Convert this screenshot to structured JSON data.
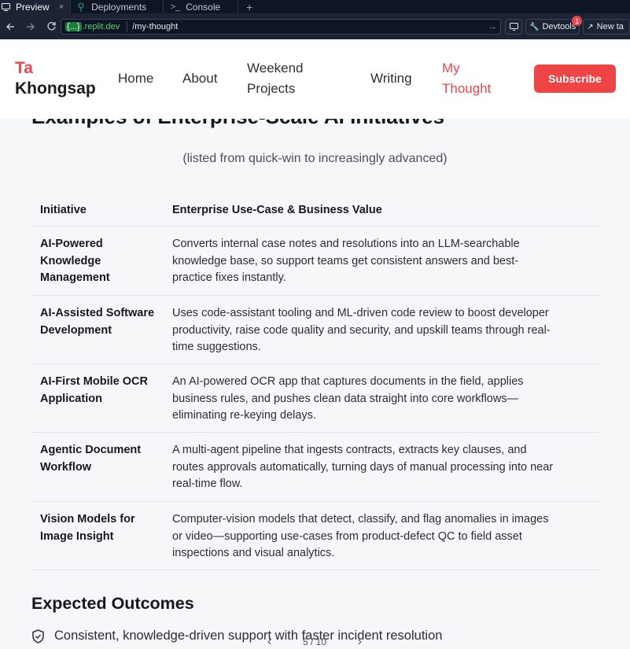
{
  "ide": {
    "tabs": [
      {
        "label": "Preview",
        "close": "×"
      },
      {
        "label": "Deployments"
      },
      {
        "label": "Console"
      }
    ],
    "new_tab_symbol": "+",
    "address": {
      "domain_braces": "{...}",
      "domain": ".replit.dev",
      "path": "/my-thought"
    },
    "devtools_label": "Devtools",
    "devtools_badge": "1",
    "new_tab_label": "New ta"
  },
  "site": {
    "logo_first": "Ta",
    "logo_last": "Khongsap",
    "nav": [
      {
        "label_lines": [
          "Home"
        ]
      },
      {
        "label_lines": [
          "About"
        ]
      },
      {
        "label_lines": [
          "Weekend",
          "Projects"
        ]
      },
      {
        "label_lines": [
          "Writing"
        ]
      },
      {
        "label_lines": [
          "My",
          "Thought"
        ],
        "active": true
      }
    ],
    "subscribe_label": "Subscribe",
    "accent_color": "#ef4444"
  },
  "article": {
    "section_heading_cut": "Examples of Enterprise-Scale AI Initiatives",
    "subtitle": "(listed from quick-win to increasingly advanced)",
    "table": {
      "headers": [
        "Initiative",
        "Enterprise Use-Case & Business Value"
      ],
      "rows": [
        {
          "initiative_lines": [
            "AI-Powered",
            "Knowledge",
            "Management"
          ],
          "value_lines": [
            "Converts internal case notes and resolutions into an LLM-searchable",
            "knowledge base, so support teams get consistent answers and best-",
            "practice fixes instantly."
          ]
        },
        {
          "initiative_lines": [
            "AI-Assisted Software",
            "Development"
          ],
          "value_lines": [
            "Uses code-assistant tooling and ML-driven code review to boost developer",
            "productivity, raise code quality and security, and upskill teams through real-",
            "time suggestions."
          ]
        },
        {
          "initiative_lines": [
            "AI-First Mobile OCR",
            "Application"
          ],
          "value_lines": [
            "An AI-powered OCR app that captures documents in the field, applies",
            "business rules, and pushes clean data straight into core workflows—",
            "eliminating re-keying delays."
          ]
        },
        {
          "initiative_lines": [
            "Agentic Document",
            "Workflow"
          ],
          "value_lines": [
            "A multi-agent pipeline that ingests contracts, extracts key clauses, and",
            "routes approvals automatically, turning days of manual processing into near",
            "real-time flow."
          ]
        },
        {
          "initiative_lines": [
            "Vision Models for",
            "Image Insight"
          ],
          "value_lines": [
            "Computer-vision models that detect, classify, and flag anomalies in images",
            "or video—supporting use-cases from product-defect QC to field asset",
            "inspections and visual analytics."
          ]
        }
      ]
    },
    "outcomes_heading": "Expected Outcomes",
    "outcomes": [
      "Consistent, knowledge-driven support with faster incident resolution"
    ],
    "pager": {
      "current": "5",
      "total": "10",
      "text": "5 / 10"
    }
  }
}
